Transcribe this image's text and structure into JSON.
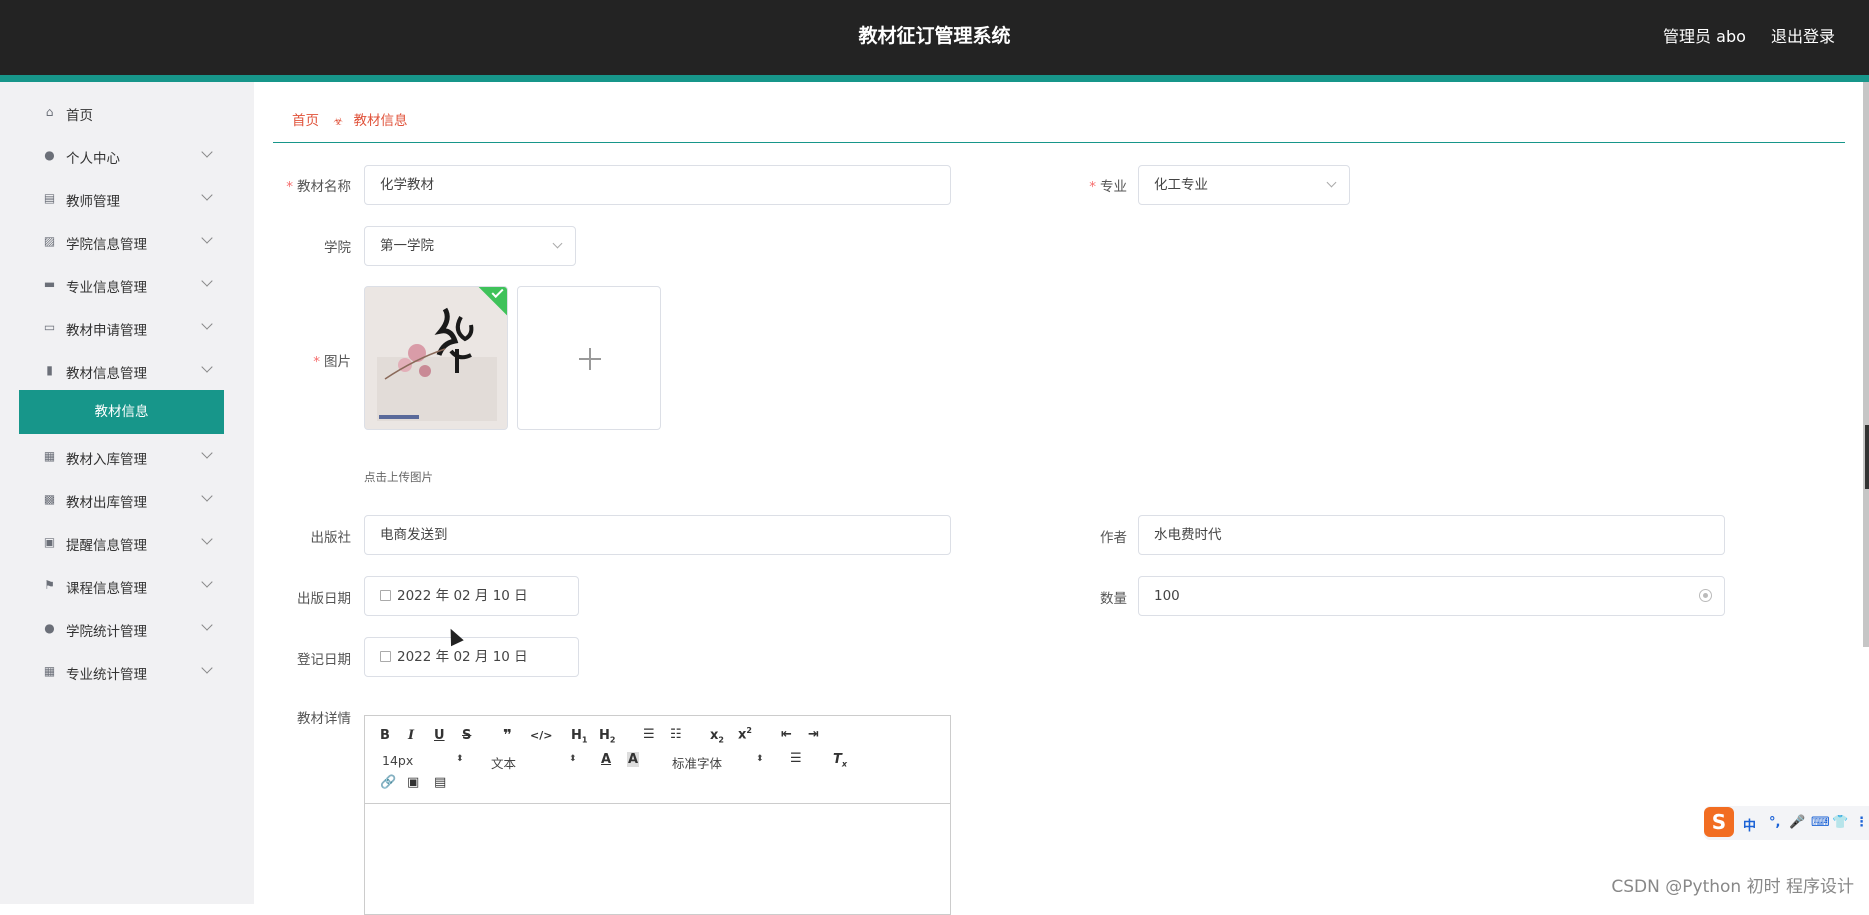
{
  "header": {
    "title": "教材征订管理系统",
    "user": "管理员 abo",
    "logout": "退出登录"
  },
  "sidebar": {
    "items": [
      {
        "label": "首页",
        "icon": "home-icon",
        "expandable": false
      },
      {
        "label": "个人中心",
        "icon": "user-icon",
        "expandable": true
      },
      {
        "label": "教师管理",
        "icon": "clipboard-icon",
        "expandable": true
      },
      {
        "label": "学院信息管理",
        "icon": "chart-icon",
        "expandable": true
      },
      {
        "label": "专业信息管理",
        "icon": "bookmark-icon",
        "expandable": true
      },
      {
        "label": "教材申请管理",
        "icon": "monitor-icon",
        "expandable": true
      },
      {
        "label": "教材信息管理",
        "icon": "thumb-icon",
        "expandable": true
      },
      {
        "label": "教材入库管理",
        "icon": "grid-icon",
        "expandable": true
      },
      {
        "label": "教材出库管理",
        "icon": "apps-icon",
        "expandable": true
      },
      {
        "label": "提醒信息管理",
        "icon": "briefcase-icon",
        "expandable": true
      },
      {
        "label": "课程信息管理",
        "icon": "flag-icon",
        "expandable": true
      },
      {
        "label": "学院统计管理",
        "icon": "user-icon",
        "expandable": true
      },
      {
        "label": "专业统计管理",
        "icon": "grid-icon",
        "expandable": true
      }
    ],
    "active_sub": "教材信息"
  },
  "breadcrumb": {
    "home": "首页",
    "current": "教材信息"
  },
  "form": {
    "name_label": "教材名称",
    "name_value": "化学教材",
    "major_label": "专业",
    "major_value": "化工专业",
    "college_label": "学院",
    "college_value": "第一学院",
    "image_label": "图片",
    "upload_hint": "点击上传图片",
    "publisher_label": "出版社",
    "publisher_value": "电商发送到",
    "author_label": "作者",
    "author_value": "水电费时代",
    "pubdate_label": "出版日期",
    "pubdate_value": "2022 年 02 月 10 日",
    "quantity_label": "数量",
    "quantity_value": "100",
    "regdate_label": "登记日期",
    "regdate_value": "2022 年 02 月 10 日",
    "detail_label": "教材详情"
  },
  "editor": {
    "font_size": "14px",
    "paragraph": "文本",
    "font_family": "标准字体"
  },
  "ime": {
    "logo": "S",
    "chars": [
      "中",
      "°,",
      "🎤",
      "⌨",
      "👕",
      "⋮"
    ]
  },
  "credit": "CSDN @Python 初时 程序设计",
  "colors": {
    "accent": "#17968a",
    "breadcrumb": "#e0523a",
    "required": "#f56c6c",
    "topbar": "#232323"
  }
}
